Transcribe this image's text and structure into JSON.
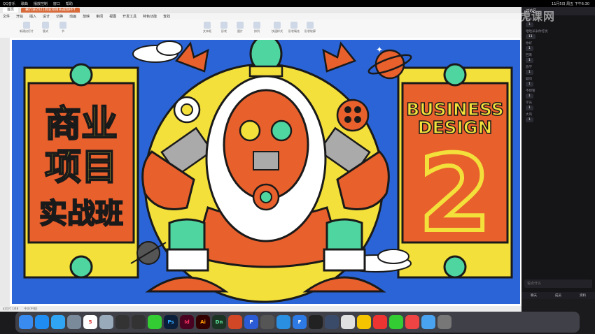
{
  "menubar": {
    "app": "QQ音乐",
    "items": [
      "歌曲",
      "播放控制",
      "窗口",
      "帮助"
    ],
    "status_time": "11月5日 周五 下午6:30"
  },
  "tabs": {
    "first": "首页",
    "doc": "第六讲2021商业项目实战班PPT"
  },
  "menu": [
    "文件",
    "开始",
    "插入",
    "设计",
    "切换",
    "动画",
    "放映",
    "审阅",
    "视图",
    "开发工具",
    "特色功能",
    "查找"
  ],
  "ribbon": [
    "新建幻灯片",
    "版式",
    "节",
    "文本框",
    "形状",
    "图片",
    "排列",
    "快速样式",
    "形状填充",
    "形状轮廓",
    "播放",
    "设置"
  ],
  "slide": {
    "left_title": [
      "商业",
      "项目",
      "实战班"
    ],
    "right_title": [
      "BUSINESS",
      "DESIGN"
    ],
    "big_number": "2",
    "colors": {
      "blue": "#2a64d6",
      "orange": "#e8602c",
      "yellow": "#f3e03b",
      "green": "#4fd6a0",
      "dark": "#1a1a1a"
    }
  },
  "status": {
    "page": "幻灯片 1/48",
    "lang": "中文(中国)"
  },
  "chat": {
    "header": "讨论区",
    "messages": [
      {
        "name": "野草",
        "text": "1"
      },
      {
        "name": "哈哈米米你打扰",
        "text": "11"
      },
      {
        "name": "你好",
        "text": "1"
      },
      {
        "name": "回来",
        "text": "1"
      },
      {
        "name": "放学",
        "text": "1"
      },
      {
        "name": "疑问",
        "text": "1"
      },
      {
        "name": "不想管",
        "text": "1"
      },
      {
        "name": "学员",
        "text": "1"
      },
      {
        "name": "大风",
        "text": "1"
      }
    ],
    "input_placeholder": "说点什么",
    "tabs": [
      "聊天",
      "成员",
      "资料"
    ]
  },
  "watermark": "虎课网",
  "dock": [
    "Finder",
    "App Store",
    "Safari",
    "Preview",
    "Calendar",
    "Photos",
    "QQ",
    "QQ",
    "WeChat",
    "Ps",
    "Id",
    "Ai",
    "Dn",
    "PowerPoint",
    "P",
    "Note",
    "Xcode",
    "F",
    "OBS",
    "C4D",
    "Wps",
    "Photos",
    "Weibo",
    "Music",
    "Video",
    "Finder",
    "Trash"
  ]
}
